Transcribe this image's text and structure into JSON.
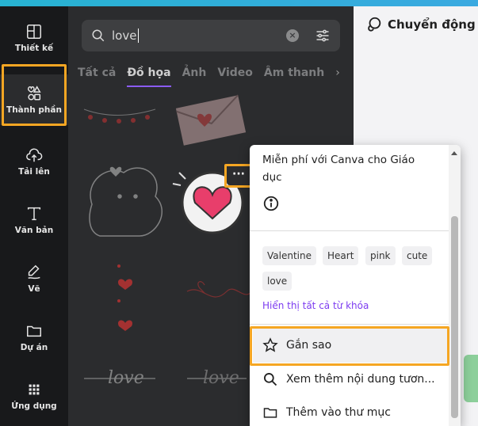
{
  "rail": {
    "items": [
      {
        "label": "Thiết kế",
        "icon": "layout-icon"
      },
      {
        "label": "Thành phần",
        "icon": "elements-icon"
      },
      {
        "label": "Tải lên",
        "icon": "cloud-upload-icon"
      },
      {
        "label": "Văn bản",
        "icon": "text-icon"
      },
      {
        "label": "Vẽ",
        "icon": "draw-icon"
      },
      {
        "label": "Dự án",
        "icon": "folder-icon"
      },
      {
        "label": "Ứng dụng",
        "icon": "apps-grid-icon"
      }
    ]
  },
  "search": {
    "query": "love"
  },
  "tabs": [
    "Tất cả",
    "Đồ họa",
    "Ảnh",
    "Video",
    "Âm thanh"
  ],
  "header": {
    "motion_label": "Chuyển động"
  },
  "menu": {
    "info_text": "Miễn phí với Canva cho Giáo dục",
    "keywords": [
      "Valentine",
      "Heart",
      "pink",
      "cute",
      "love"
    ],
    "show_all_keywords": "Hiển thị tất cả từ khóa",
    "star_label": "Gắn sao",
    "see_more_label": "Xem thêm nội dung tươn...",
    "add_folder_label": "Thêm vào thư mục"
  },
  "more_button_label": "···",
  "colors": {
    "accent_highlight": "#f5a623",
    "tab_underline": "#8b5cf6",
    "link": "#7d3cf0"
  }
}
